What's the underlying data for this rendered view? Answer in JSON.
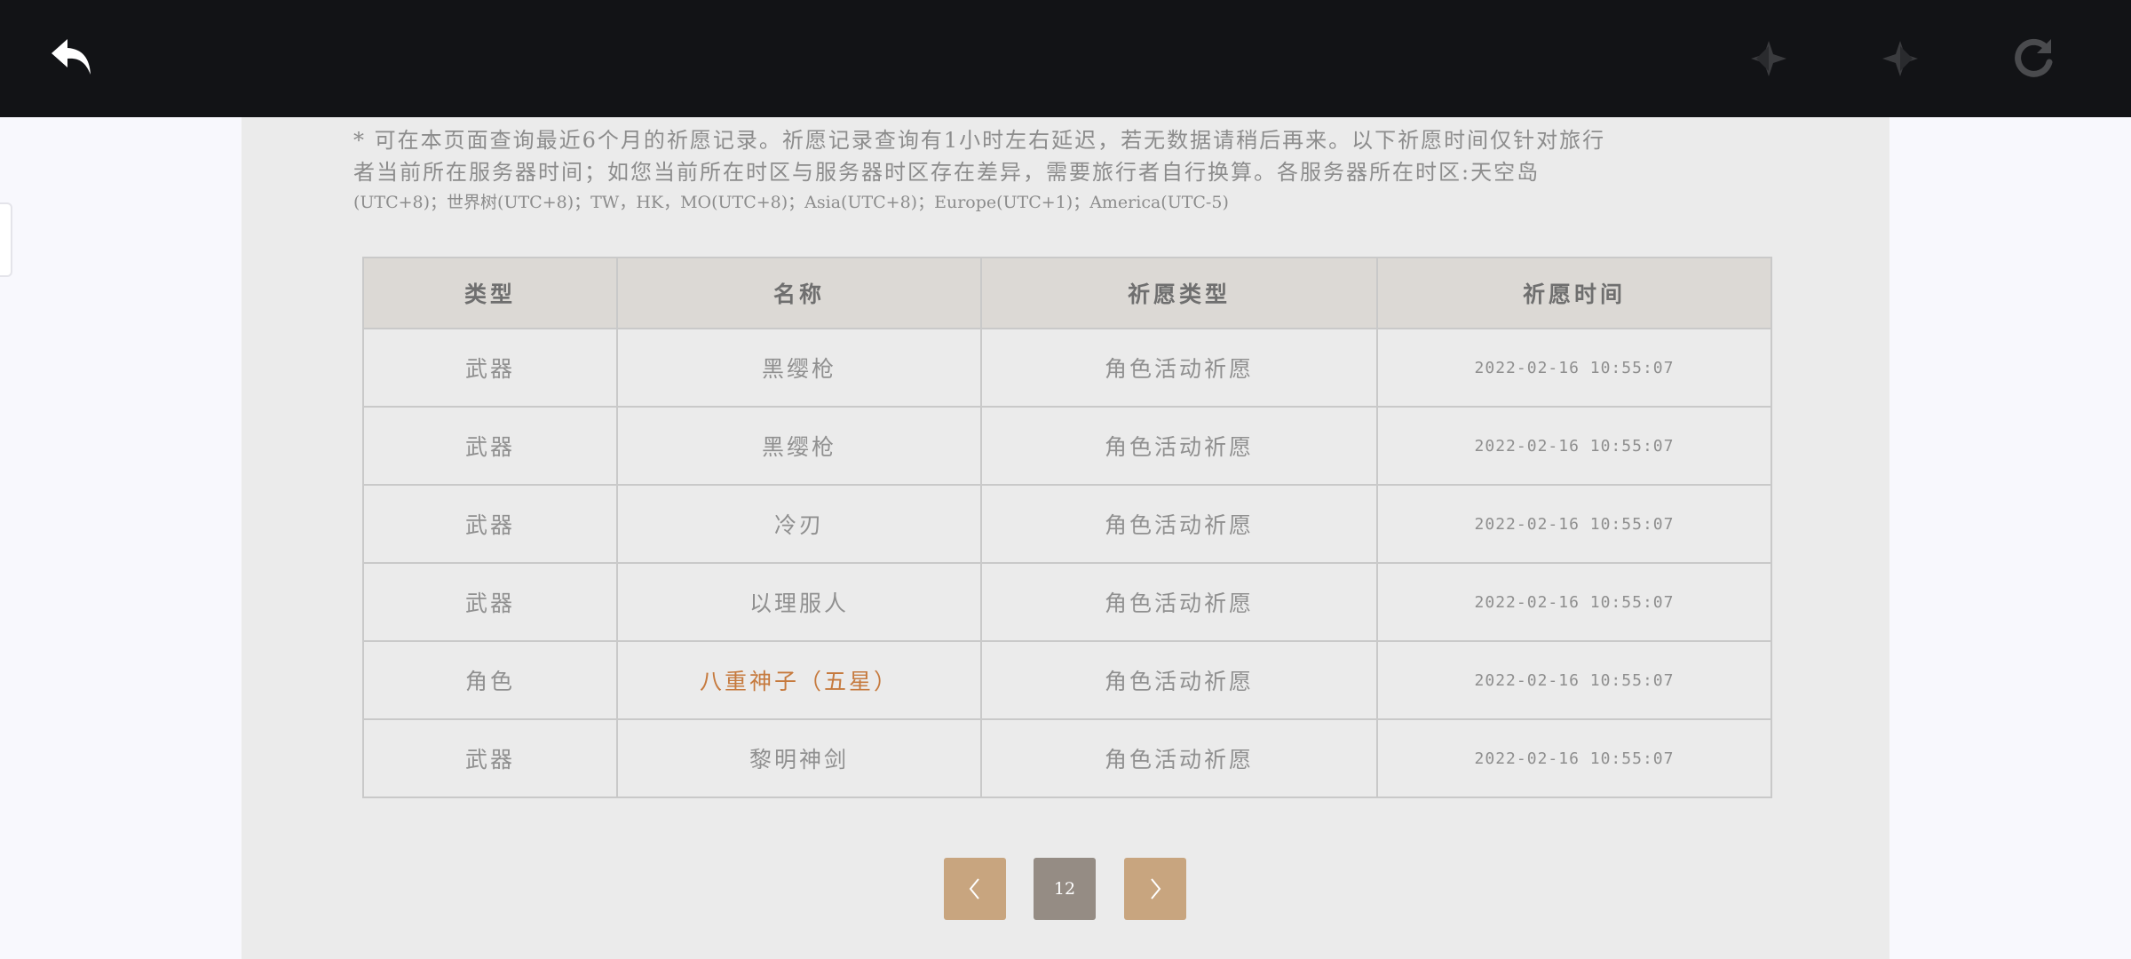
{
  "toolbar": {
    "back_icon": "back-arrow-icon",
    "prev_icon": "diamond-left-icon",
    "next_icon": "diamond-right-icon",
    "refresh_icon": "refresh-icon"
  },
  "notice": {
    "line1": "* 可在本页面查询最近6个月的祈愿记录。祈愿记录查询有1小时左右延迟，若无数据请稍后再来。以下祈愿时间仅针对旅行",
    "line2": "者当前所在服务器时间；如您当前所在时区与服务器时区存在差异，需要旅行者自行换算。各服务器所在时区:天空岛",
    "line3": "(UTC+8)；世界树(UTC+8)；TW，HK，MO(UTC+8)；Asia(UTC+8)；Europe(UTC+1)；America(UTC-5)"
  },
  "table": {
    "headers": [
      "类型",
      "名称",
      "祈愿类型",
      "祈愿时间"
    ],
    "rows": [
      [
        "武器",
        "黑缨枪",
        "角色活动祈愿",
        "2022-02-16 10:55:07"
      ],
      [
        "武器",
        "黑缨枪",
        "角色活动祈愿",
        "2022-02-16 10:55:07"
      ],
      [
        "武器",
        "冷刃",
        "角色活动祈愿",
        "2022-02-16 10:55:07"
      ],
      [
        "武器",
        "以理服人",
        "角色活动祈愿",
        "2022-02-16 10:55:07"
      ],
      [
        "角色",
        "八重神子（五星）",
        "角色活动祈愿",
        "2022-02-16 10:55:07"
      ],
      [
        "武器",
        "黎明神剑",
        "角色活动祈愿",
        "2022-02-16 10:55:07"
      ]
    ]
  },
  "colors": {
    "five_star": "#c67a3e",
    "header_bg": "#dcd9d5",
    "pager_nav": "#c8a57f",
    "pager_current": "#958c84"
  },
  "pagination": {
    "prev_icon": "chevron-left-icon",
    "current_page": "12",
    "next_icon": "chevron-right-icon"
  }
}
